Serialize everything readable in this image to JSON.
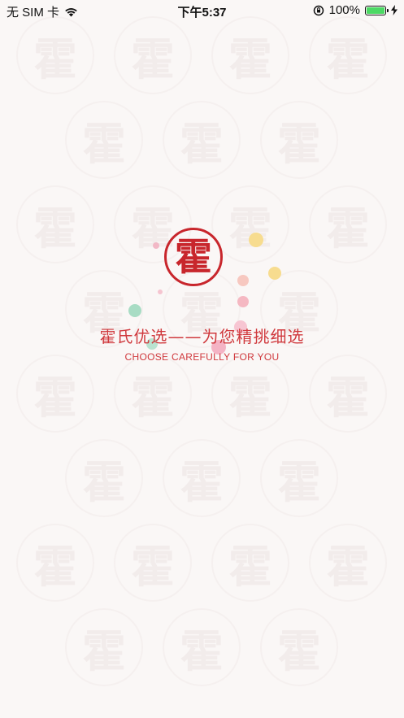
{
  "status_bar": {
    "carrier": "无 SIM 卡",
    "time": "下午5:37",
    "battery_percent": "100%",
    "battery_level": 1.0
  },
  "splash": {
    "logo_char": "霍",
    "tagline": "霍氏优选——为您精挑细选",
    "subtagline": "CHOOSE CAREFULLY FOR YOU"
  },
  "colors": {
    "brand_red": "#c8262c",
    "background": "#faf7f6",
    "battery_green": "#4cd964"
  }
}
